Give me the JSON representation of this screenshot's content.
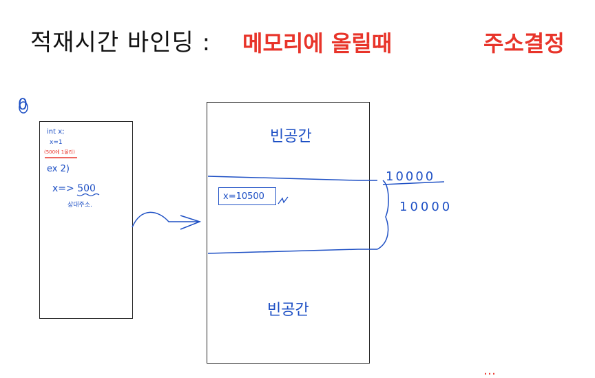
{
  "title": {
    "left": "적재시간 바인딩 :",
    "middle": "메모리에 올릴때",
    "right": "주소결정"
  },
  "marker": "0",
  "program_box": {
    "line1": "int x;",
    "line2": "x=1",
    "line3": "(500에 1올리)",
    "example": "ex 2)",
    "addr": "x=> 500",
    "relative_note": "상대주소."
  },
  "memory": {
    "top_label": "빈공간",
    "bottom_label": "빈공간",
    "variable": "x=10500",
    "start_address": "10000",
    "size": "10000"
  },
  "footer": {
    "red_text": "…"
  },
  "colors": {
    "blue_ink": "#1d4fc4",
    "red_ink": "#e8342a",
    "black_ink": "#111111"
  }
}
